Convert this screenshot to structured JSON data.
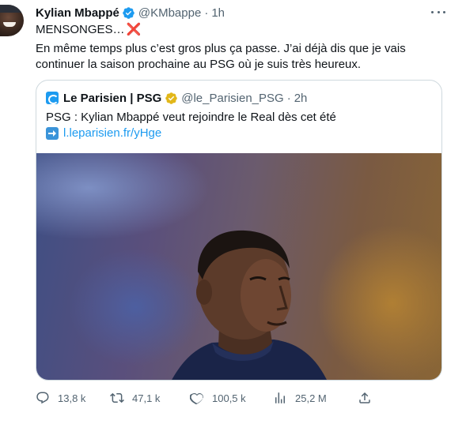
{
  "tweet": {
    "author_name": "Kylian Mbappé",
    "author_handle": "@KMbappe",
    "separator": "·",
    "time": "1h",
    "line1": "MENSONGES…",
    "line1_emoji": "❌",
    "line2": "En même temps plus c’est gros plus ça passe. J’ai déjà dis que je vais",
    "line3": "continuer la saison prochaine au PSG où je suis très heureux."
  },
  "quote": {
    "name": "Le Parisien | PSG",
    "handle": "@le_Parisien_PSG",
    "separator": "·",
    "time": "2h",
    "text": "PSG : Kylian Mbappé veut rejoindre le Real dès cet été",
    "link_emoji": "➡️",
    "link": "l.leparisien.fr/yHge"
  },
  "actions": {
    "replies": "13,8 k",
    "retweets": "47,1 k",
    "likes": "100,5 k",
    "views": "25,2 M"
  },
  "icons": {
    "verified": "verified-badge-icon",
    "more": "more-icon",
    "reply": "reply-icon",
    "retweet": "retweet-icon",
    "like": "like-icon",
    "views": "views-icon",
    "share": "share-icon"
  },
  "colors": {
    "accent": "#1d9bf0",
    "text": "#0f1419",
    "secondary": "#536471",
    "border": "#cfd9de",
    "gold_badge": "#e2b719",
    "cross": "#e0245e"
  }
}
